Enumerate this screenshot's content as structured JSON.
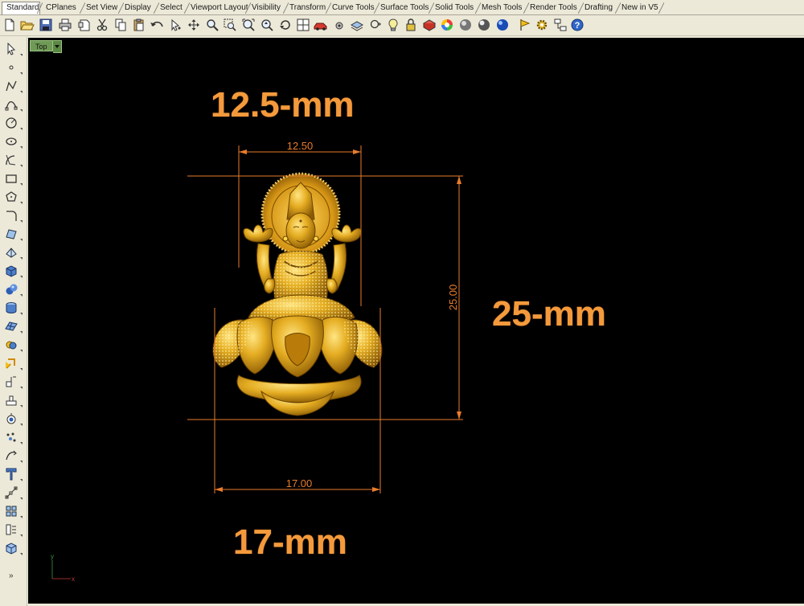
{
  "tabs": [
    {
      "label": "Standard",
      "active": true
    },
    {
      "label": "CPlanes"
    },
    {
      "label": "Set View"
    },
    {
      "label": "Display"
    },
    {
      "label": "Select"
    },
    {
      "label": "Viewport Layout"
    },
    {
      "label": "Visibility"
    },
    {
      "label": "Transform"
    },
    {
      "label": "Curve Tools"
    },
    {
      "label": "Surface Tools"
    },
    {
      "label": "Solid Tools"
    },
    {
      "label": "Mesh Tools"
    },
    {
      "label": "Render Tools"
    },
    {
      "label": "Drafting"
    },
    {
      "label": "New in V5"
    }
  ],
  "viewport": {
    "name": "Top",
    "axis_x": "x",
    "axis_y": "y"
  },
  "dimensions": {
    "width_top": "12.50",
    "height_right": "25.00",
    "width_bottom": "17.00"
  },
  "annotations": {
    "top": "12.5-mm",
    "right": "25-mm",
    "bottom": "17-mm"
  },
  "left_toolbar": {
    "more": "»"
  },
  "colors": {
    "dimension": "#e87c2c",
    "annotation": "#f49a3c",
    "gold": "#e1a81d",
    "viewport_label": "#6f9a55"
  }
}
